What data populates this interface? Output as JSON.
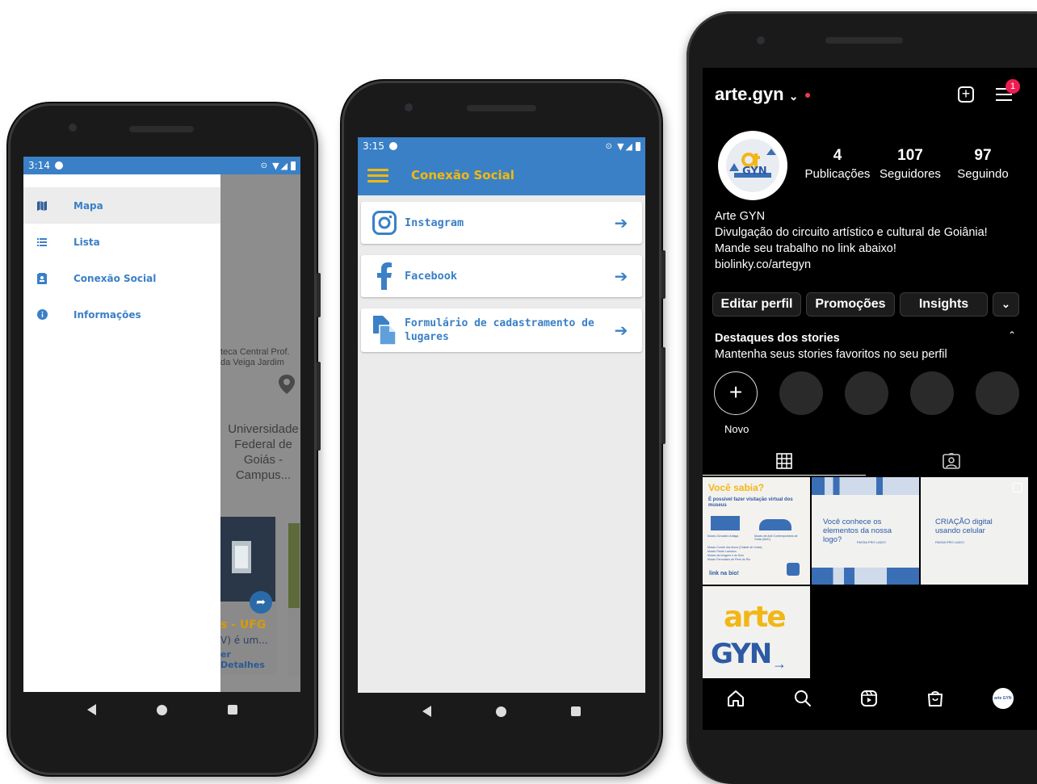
{
  "phone1": {
    "status_time": "3:14",
    "drawer_items": [
      {
        "label": "Mapa",
        "icon": "map-icon"
      },
      {
        "label": "Lista",
        "icon": "list-icon"
      },
      {
        "label": "Conexão Social",
        "icon": "contact-card-icon"
      },
      {
        "label": "Informações",
        "icon": "info-icon"
      }
    ],
    "map": {
      "place_label_line1": "teca Central Prof.",
      "place_label_line2": "da Veiga Jardim",
      "university_label": "Universidade\nFederal de\nGoiás -\nCampus...",
      "card_title": "s - UFG",
      "card_desc": "V) é um...",
      "card_link": "er Detalhes"
    }
  },
  "phone2": {
    "status_time": "3:15",
    "title": "Conexão Social",
    "items": [
      {
        "label": "Instagram",
        "icon": "instagram-icon"
      },
      {
        "label": "Facebook",
        "icon": "facebook-icon"
      },
      {
        "label": "Formulário de cadastramento de lugares",
        "icon": "form-document-icon"
      }
    ]
  },
  "phone3": {
    "username": "arte.gyn",
    "menu_badge": "1",
    "stats": [
      {
        "value": "4",
        "label": "Publicações"
      },
      {
        "value": "107",
        "label": "Seguidores"
      },
      {
        "value": "97",
        "label": "Seguindo"
      }
    ],
    "bio": {
      "name": "Arte GYN",
      "line1": "Divulgação do circuito artístico e cultural de Goiânia!",
      "line2": "Mande seu trabalho no link abaixo!",
      "link": "biolinky.co/artegyn"
    },
    "buttons": {
      "edit": "Editar perfil",
      "promos": "Promoções",
      "insights": "Insights"
    },
    "highlights": {
      "title": "Destaques dos stories",
      "subtitle": "Mantenha seus stories favoritos no seu perfil",
      "new_label": "Novo"
    },
    "posts": [
      {
        "title": "Você sabia?",
        "subtitle": "É possível fazer visitação virtual dos museus",
        "museums": "Museu Conde dos Arcos (Cidade de Goiás)\nMuseu Padre Ludovico\nMuseu da Imagem e do Som\nMuseu Ferroviário de Pires do Rio",
        "caption_left": "Museu Zoroastro Artiaga",
        "caption_right": "Museu de Arte Contemporânea de Goiás (MAC)",
        "link": "link na bio!"
      },
      {
        "text": "Você conhece os elementos da nossa logo?",
        "swipe": "PASSA PRO LADO!"
      },
      {
        "text": "CRIAÇÃO digital usando celular",
        "swipe": "PASSA PRO LADO!"
      },
      {
        "logo_line1": "arte",
        "logo_line2": "GYN"
      }
    ],
    "logo_text": "arte GYN"
  }
}
